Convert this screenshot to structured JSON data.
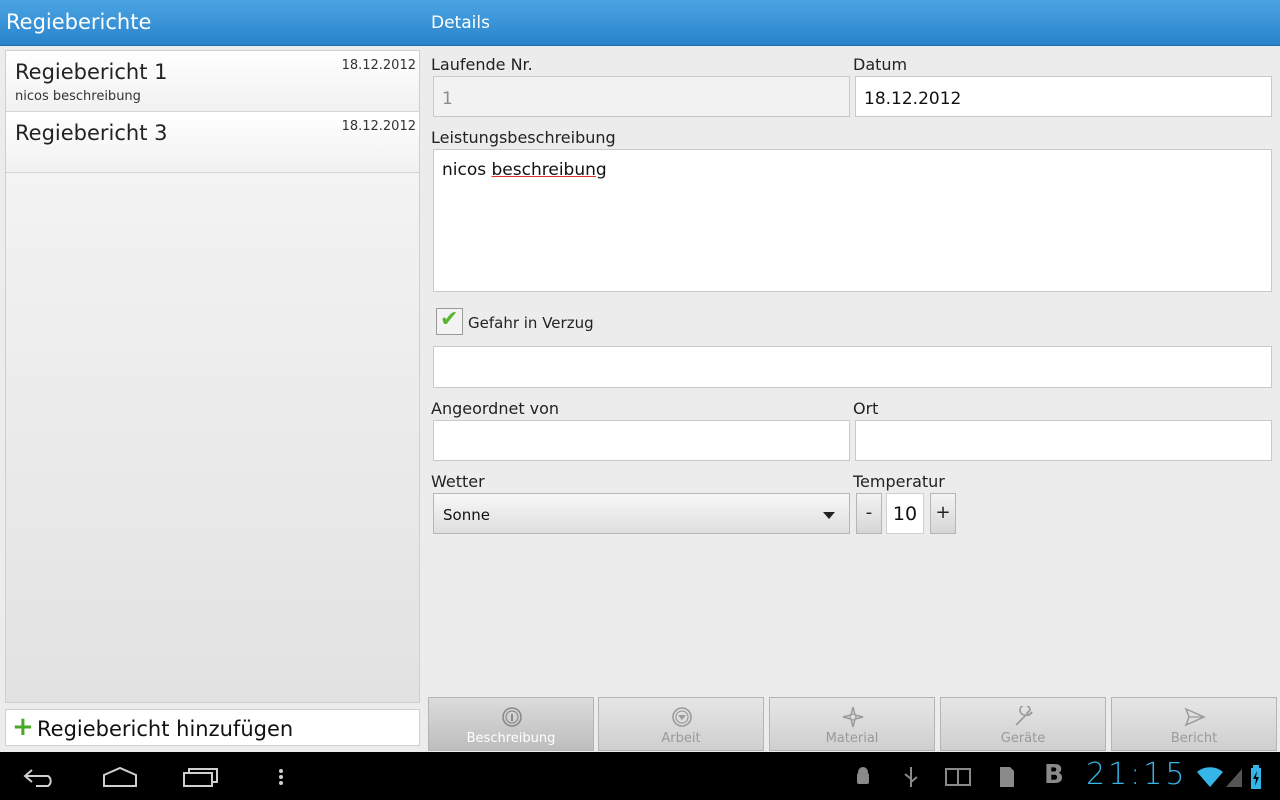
{
  "header": {
    "left_title": "Regieberichte",
    "right_title": "Details"
  },
  "list": {
    "items": [
      {
        "title": "Regiebericht 1",
        "subtitle": "nicos beschreibung",
        "date": "18.12.2012"
      },
      {
        "title": "Regiebericht 3",
        "subtitle": "",
        "date": "18.12.2012"
      }
    ],
    "add_plus": "+",
    "add_label": "Regiebericht hinzufügen"
  },
  "form": {
    "laufende_nr_label": "Laufende Nr.",
    "laufende_nr_value": "1",
    "datum_label": "Datum",
    "datum_value": "18.12.2012",
    "leistung_label": "Leistungsbeschreibung",
    "leistung_word1": "nicos",
    "leistung_word2": "beschreibung",
    "gefahr_label": "Gefahr in Verzug",
    "gefahr_checked": true,
    "gefahr_check_glyph": "✔",
    "gefahr_text": "",
    "angeordnet_label": "Angeordnet von",
    "angeordnet_value": "",
    "ort_label": "Ort",
    "ort_value": "",
    "wetter_label": "Wetter",
    "wetter_value": "Sonne",
    "temperatur_label": "Temperatur",
    "temp_minus": "-",
    "temp_value": "10",
    "temp_plus": "+"
  },
  "tabs": [
    {
      "label": "Beschreibung",
      "icon": "info-icon",
      "active": true
    },
    {
      "label": "Arbeit",
      "icon": "arrow-down-circle-icon",
      "active": false
    },
    {
      "label": "Material",
      "icon": "compass-icon",
      "active": false
    },
    {
      "label": "Geräte",
      "icon": "wrench-icon",
      "active": false
    },
    {
      "label": "Bericht",
      "icon": "send-icon",
      "active": false
    }
  ],
  "system": {
    "clock": "21:15",
    "status_b": "B",
    "accent": "#35b5e8"
  }
}
